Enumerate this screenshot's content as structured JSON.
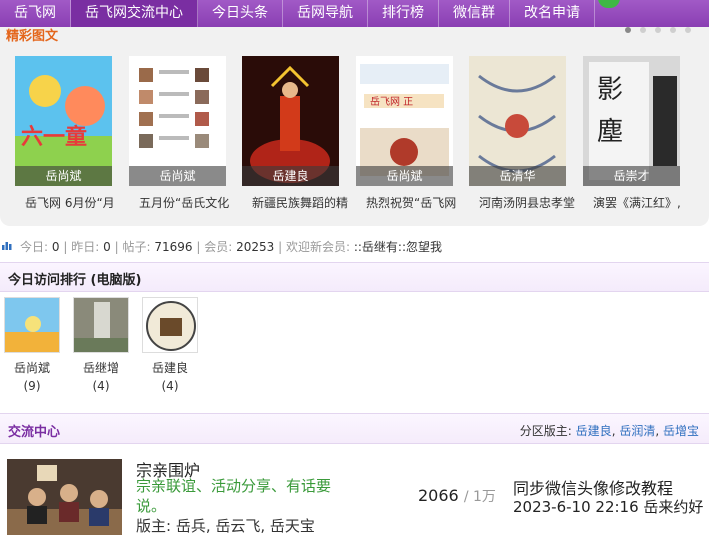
{
  "nav": {
    "items": [
      "岳飞网",
      "岳飞网交流中心",
      "今日头条",
      "岳网导航",
      "排行榜",
      "微信群",
      "改名申请"
    ],
    "active_index": 1
  },
  "gallery": {
    "title": "精彩图文",
    "slides": [
      {
        "author": "岳尚斌",
        "caption": "岳飞网 6月份“月"
      },
      {
        "author": "岳尚斌",
        "caption": "五月份“岳氏文化"
      },
      {
        "author": "岳建良",
        "caption": "新疆民族舞蹈的精"
      },
      {
        "author": "岳尚斌",
        "caption": "热烈祝贺“岳飞网"
      },
      {
        "author": "岳清华",
        "caption": "河南汤阴县忠孝堂"
      },
      {
        "author": "岳崇才",
        "caption": "演罢《满江红》,"
      }
    ]
  },
  "stats": {
    "today_label": "今日:",
    "today": "0",
    "yesterday_label": "昨日:",
    "yesterday": "0",
    "posts_label": "帖子:",
    "posts": "71696",
    "members_label": "会员:",
    "members": "20253",
    "welcome_label": "欢迎新会员:",
    "newest_member": "::岳继有::忽望我"
  },
  "ranking": {
    "title": "今日访问排行 (电脑版)",
    "items": [
      {
        "name": "岳尚斌",
        "count": "(9)"
      },
      {
        "name": "岳继增",
        "count": "(4)"
      },
      {
        "name": "岳建良",
        "count": "(4)"
      }
    ]
  },
  "forum": {
    "section_title": "交流中心",
    "moderators_label": "分区版主:",
    "moderators": [
      "岳建良",
      "岳润清",
      "岳增宝"
    ],
    "board": {
      "name": "宗亲围炉",
      "description": "宗亲联谊、活动分享、有话要说。",
      "moderators_line": "版主: 岳兵, 岳云飞, 岳天宝",
      "threads": "2066",
      "posts": "1万",
      "last_post_title": "同步微信头像修改教程",
      "last_post_time": "2023-6-10 22:16 岳来约好"
    }
  }
}
